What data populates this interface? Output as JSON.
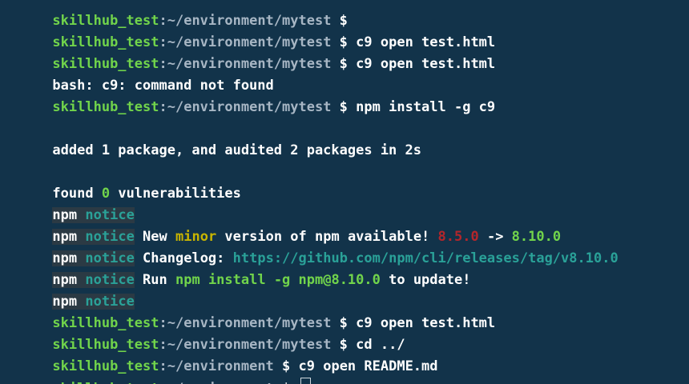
{
  "prompt": {
    "user": "skillhub_test",
    "colon": ":",
    "path_mytest": "~/environment/mytest",
    "path_env": "~/environment",
    "dollar": " $ "
  },
  "lines": {
    "l0_cmd": "",
    "l1_cmd": "c9 open test.html",
    "l2_out": "bash: c9: command not found",
    "l3_cmd": "npm install -g c9",
    "l5_out": "added 1 package, and audited 2 packages in 2s",
    "l7_found": "found ",
    "l7_zero": "0",
    "l7_rest": " vulnerabilities",
    "npm": "npm",
    "notice": "notice",
    "l9_new": " New ",
    "l9_minor": "minor",
    "l9_mid": " version of npm available! ",
    "l9_old": "8.5.0",
    "l9_arrow": " -> ",
    "l9_newver": "8.10.0",
    "l10_changelog": " Changelog: ",
    "l10_link": "https://github.com/npm/cli/releases/tag/v8.10.0",
    "l11_run": " Run ",
    "l11_cmd": "npm install -g npm@8.10.0",
    "l11_rest": " to update!",
    "l13_cmd": "c9 open test.html",
    "l14_cmd": "cd ../",
    "l15_cmd": "c9 open README.md",
    "l16_cmd": ""
  }
}
